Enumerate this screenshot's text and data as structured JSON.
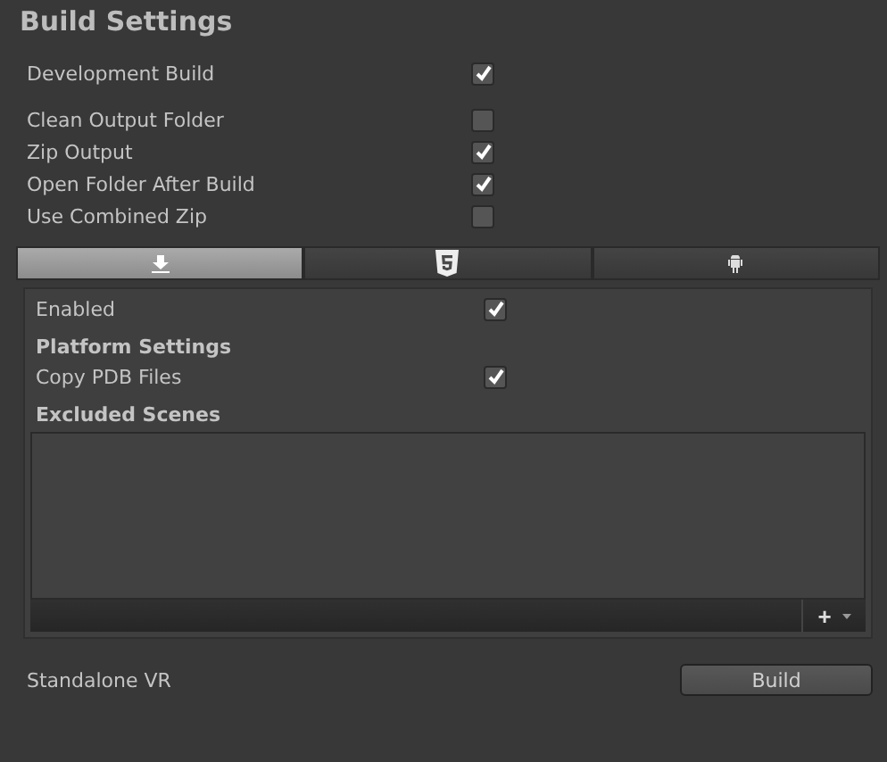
{
  "title": "Build Settings",
  "option_groups": [
    [
      {
        "label": "Development Build",
        "checked": true
      }
    ],
    [
      {
        "label": "Clean Output Folder",
        "checked": false
      },
      {
        "label": "Zip Output",
        "checked": true
      },
      {
        "label": "Open Folder After Build",
        "checked": true
      },
      {
        "label": "Use Combined Zip",
        "checked": false
      }
    ]
  ],
  "tabs": [
    {
      "kind": "download",
      "selected": true
    },
    {
      "kind": "html5",
      "selected": false
    },
    {
      "kind": "android",
      "selected": false
    }
  ],
  "panel": {
    "enabled": {
      "label": "Enabled",
      "checked": true
    },
    "platform_heading": "Platform Settings",
    "platform_options": [
      {
        "label": "Copy PDB Files",
        "checked": true
      }
    ],
    "scenes_heading": "Excluded Scenes",
    "add_button": "+"
  },
  "vr_label": "Standalone VR",
  "build_button": "Build"
}
